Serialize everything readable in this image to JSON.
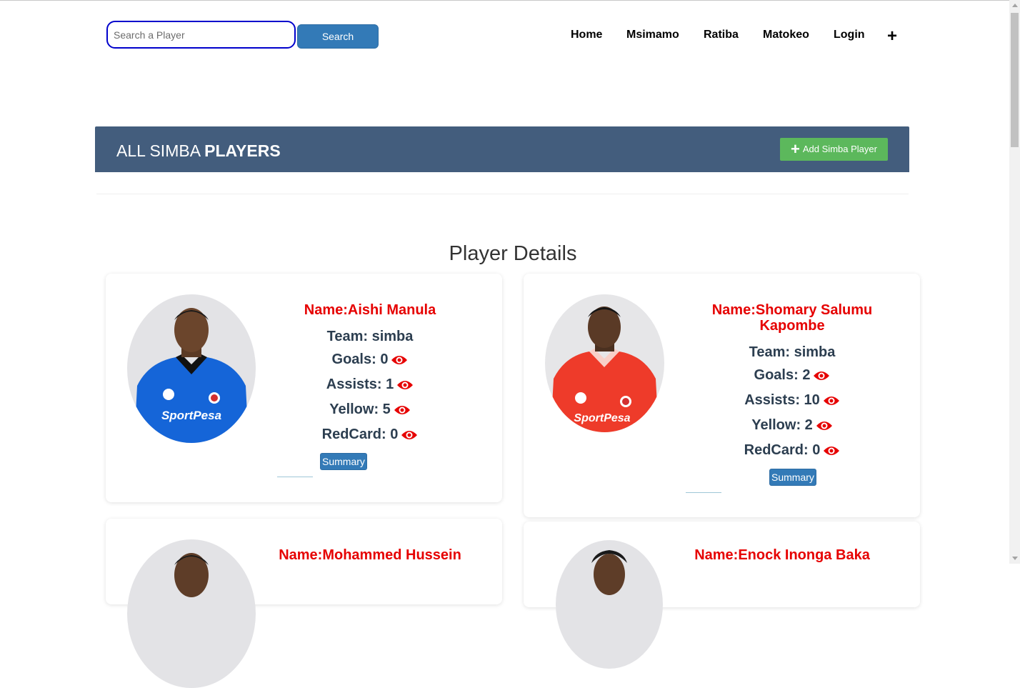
{
  "search": {
    "placeholder": "Search a Player",
    "button_label": "Search"
  },
  "nav": {
    "items": [
      "Home",
      "Msimamo",
      "Ratiba",
      "Matokeo",
      "Login"
    ],
    "plus_label": "+"
  },
  "header": {
    "title_light": "ALL SIMBA ",
    "title_bold": "PLAYERS",
    "add_button_label": "Add Simba Player"
  },
  "section_title": "Player Details",
  "colors": {
    "header_bg": "#435d7d",
    "add_green": "#5cb85c",
    "name_red": "#e60000",
    "stat_text": "#2c3e50",
    "primary_blue": "#337ab7"
  },
  "players": [
    {
      "name": "Name:Aishi Manula",
      "team": "Team: simba",
      "goals": "Goals: 0",
      "assists": "Assists: 1",
      "yellow": "Yellow: 5",
      "redcard": "RedCard: 0",
      "summary_label": "Summary",
      "jersey": "blue",
      "sponsor": "SportPesa"
    },
    {
      "name": "Name:Shomary Salumu Kapombe",
      "team": "Team: simba",
      "goals": "Goals: 2",
      "assists": "Assists: 10",
      "yellow": "Yellow: 2",
      "redcard": "RedCard: 0",
      "summary_label": "Summary",
      "jersey": "red",
      "sponsor": "SportPesa"
    },
    {
      "name": "Name:Mohammed Hussein"
    },
    {
      "name": "Name:Enock Inonga Baka"
    }
  ]
}
